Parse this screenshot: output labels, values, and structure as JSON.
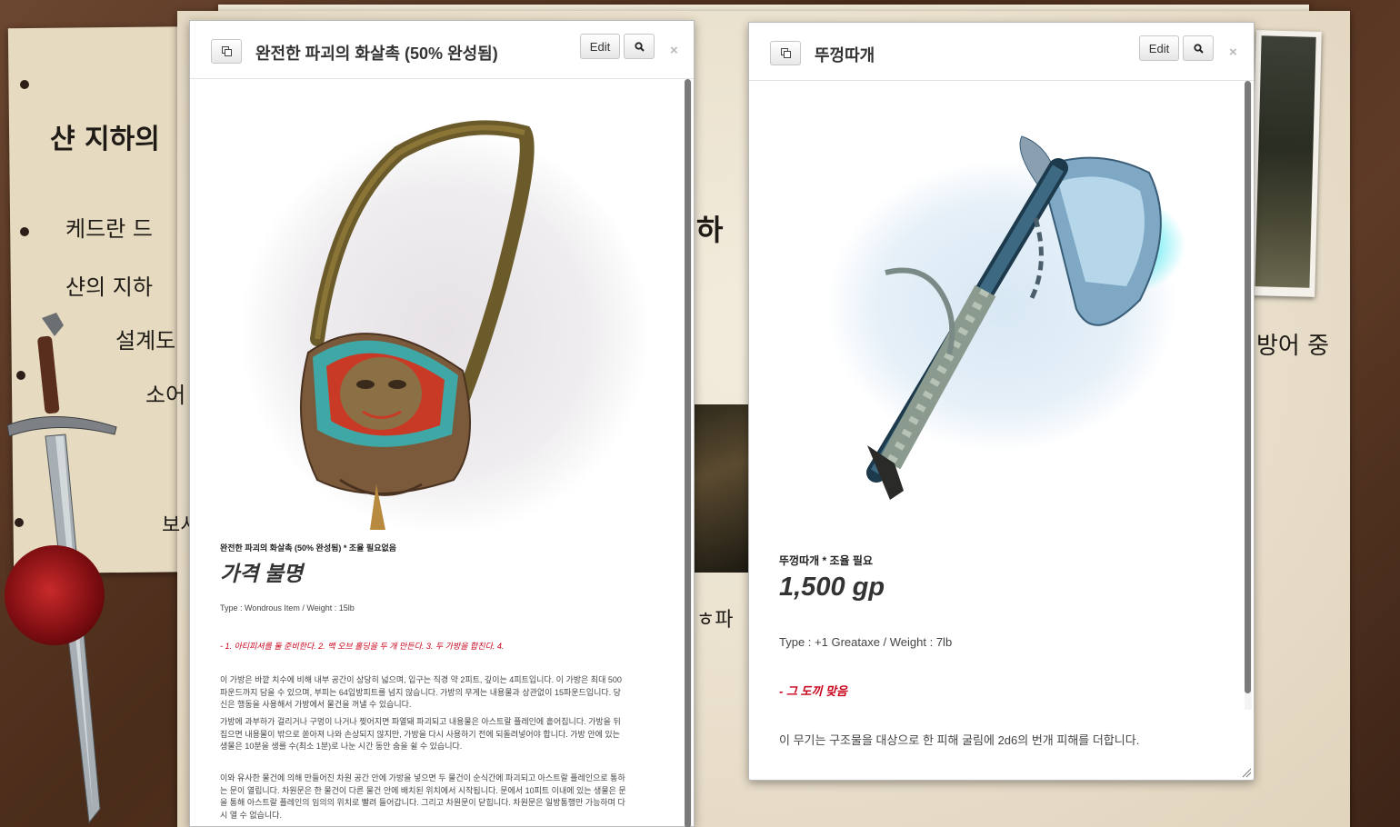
{
  "background": {
    "notes": [
      "샨 지하의",
      "케드란 드",
      "샨의 지하",
      "설계도",
      "소어",
      "보시",
      "하",
      "방어 중",
      "ㅎ파"
    ]
  },
  "windows": [
    {
      "title": "완전한 파괴의 화살촉 (50% 완성됨)",
      "edit_label": "Edit",
      "close_label": "×",
      "item_line": "완전한 파괴의 화살촉 (50% 완성됨) * 조율 필요없음",
      "price": "가격 불명",
      "meta": "Type : Wondrous Item / Weight : 15lb",
      "recipe": "- 1. 아티피셔를 둘 준비한다. 2. 백 오브 홀딩을 두 개 만든다. 3. 두 가방을 합친다. 4.",
      "paragraphs": [
        "이 가방은 바깥 치수에 비해 내부 공간이 상당히 넓으며, 입구는 직경 약 2피트, 깊이는 4피트입니다. 이 가방은 최대 500파운드까지 담을 수 있으며, 부피는 64입방피트를 넘지 않습니다. 가방의 무게는 내용물과 상관없이 15파운드입니다. 당신은 행동을 사용해서 가방에서 물건을 꺼낼 수 있습니다.",
        "가방에 과부하가 걸리거나 구멍이 나거나 찢어지면 파열돼 파괴되고 내용물은 아스트랄 플레인에 흩어집니다. 가방을 뒤집으면 내용물이 밖으로 쏟아져 나와 손상되지 않지만, 가방을 다시 사용하기 전에 되돌려넣어야 합니다. 가방 안에 있는 생물은 10분을 생를 수(최소 1분)로 나눈 시간 동안 숨을 쉴 수 있습니다.",
        "이와 유사한 물건에 의해 만들어진 차원 공간 안에 가방을 넣으면 두 물건이 순식간에 파괴되고 아스트랄 플레인으로 통하는 문이 열립니다. 차원문은 한 물건이 다른 물건 안에 배치된 위치에서 시작됩니다. 문에서 10피트 이내에 있는 생물은 문을 통해 아스트랄 플레인의 임의의 위치로 빨려 들어갑니다. 그리고 차원문이 닫힙니다. 차원문은 일방통행만 가능하며 다시 열 수 없습니다."
      ]
    },
    {
      "title": "뚜껑따개",
      "edit_label": "Edit",
      "close_label": "×",
      "item_line": "뚜껑따개 * 조율 필요",
      "price": "1,500 gp",
      "meta": "Type : +1 Greataxe / Weight : 7lb",
      "recipe": "- 그 도끼 맞음",
      "description": "이 무기는 구조물을 대상으로 한 피해 굴림에 2d6의 번개 피해를 더합니다."
    }
  ],
  "colors": {
    "recipe_red": "#c8001a",
    "glow_cyan": "#3fe6f0"
  },
  "icons": [
    "popout-icon",
    "search-icon",
    "close-icon",
    "resize-grip-icon"
  ]
}
